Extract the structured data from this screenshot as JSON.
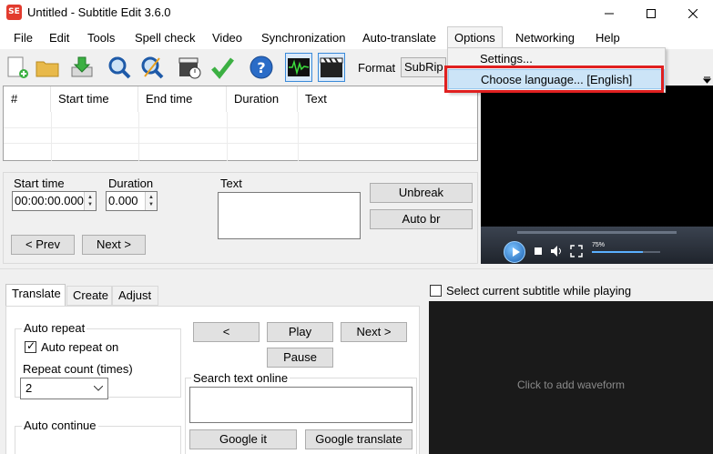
{
  "window": {
    "title": "Untitled - Subtitle Edit 3.6.0",
    "app_icon": "SE"
  },
  "menu": [
    "File",
    "Edit",
    "Tools",
    "Spell check",
    "Video",
    "Synchronization",
    "Auto-translate",
    "Options",
    "Networking",
    "Help"
  ],
  "options_menu": {
    "settings": "Settings...",
    "choose_language": "Choose language... [English]"
  },
  "toolbar": {
    "format_label": "Format",
    "format_value": "SubRip"
  },
  "grid": {
    "columns": [
      "#",
      "Start time",
      "End time",
      "Duration",
      "Text"
    ]
  },
  "edit": {
    "start_time_label": "Start time",
    "start_time_value": "00:00:00.000",
    "duration_label": "Duration",
    "duration_value": "0.000",
    "text_label": "Text",
    "prev": "< Prev",
    "next": "Next >",
    "unbreak": "Unbreak",
    "auto_br": "Auto br"
  },
  "video": {
    "volume_label": "75%"
  },
  "bottom": {
    "tabs": [
      "Translate",
      "Create",
      "Adjust"
    ],
    "auto_repeat_group": "Auto repeat",
    "auto_repeat_on": "Auto repeat on",
    "repeat_count_label": "Repeat count (times)",
    "repeat_count_value": "2",
    "auto_continue_group": "Auto continue",
    "btn_prev": "<",
    "btn_play": "Play",
    "btn_next": "Next >",
    "btn_pause": "Pause",
    "search_label": "Search text online",
    "google_it": "Google it",
    "google_translate": "Google translate"
  },
  "select_current": "Select current subtitle while playing",
  "waveform": {
    "hint": "Click to add waveform"
  }
}
